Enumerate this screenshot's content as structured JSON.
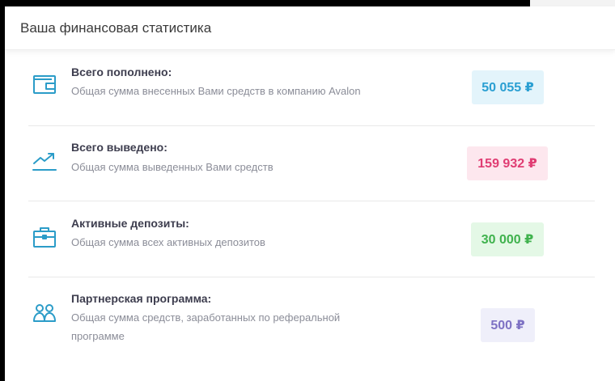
{
  "card": {
    "title": "Ваша финансовая статистика"
  },
  "rows": [
    {
      "icon": "wallet-icon",
      "title": "Всего пополнено:",
      "description": "Общая сумма внесенных Вами средств в компанию Avalon",
      "value": "50 055 ₽",
      "badge_bg": "#e3f4fb",
      "badge_color": "#2a9fd2"
    },
    {
      "icon": "trending-up-icon",
      "title": "Всего выведено:",
      "description": "Общая сумма выведенных Вами средств",
      "value": "159 932 ₽",
      "badge_bg": "#fde7ee",
      "badge_color": "#e03d73"
    },
    {
      "icon": "briefcase-icon",
      "title": "Активные депозиты:",
      "description": "Общая сумма всех активных депозитов",
      "value": "30 000 ₽",
      "badge_bg": "#e4f8e6",
      "badge_color": "#3fb24d"
    },
    {
      "icon": "users-icon",
      "title": "Партнерская программа:",
      "description": "Общая сумма средств, заработанных по реферальной программе",
      "value": "500 ₽",
      "badge_bg": "#efeffa",
      "badge_color": "#7e72c4"
    }
  ],
  "colors": {
    "icon_accent": "#2b9cc8"
  }
}
